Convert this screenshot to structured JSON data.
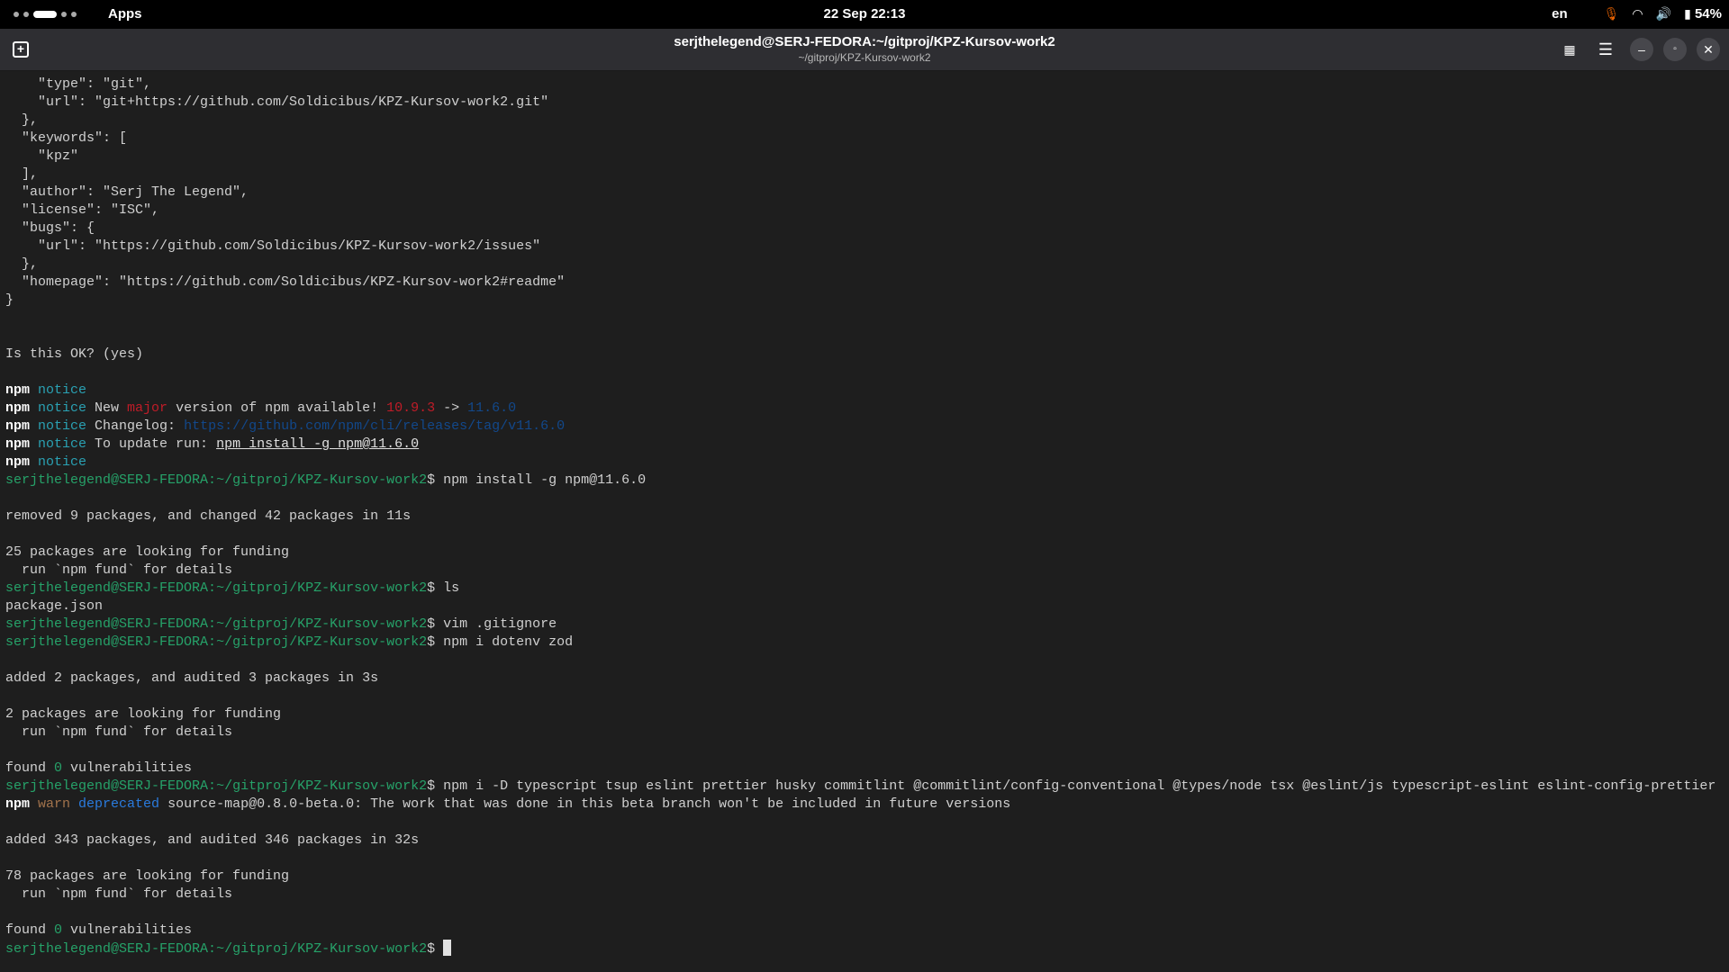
{
  "topbar": {
    "apps": "Apps",
    "datetime": "22 Sep  22:13",
    "lang": "en",
    "battery": "54%"
  },
  "window": {
    "title": "serjthelegend@SERJ-FEDORA:~/gitproj/KPZ-Kursov-work2",
    "subtitle": "~/gitproj/KPZ-Kursov-work2"
  },
  "colors": {
    "prompt": "#26a269",
    "notice": "#2aa1b3",
    "major": "#c01c28",
    "link": "#12488b",
    "warn": "#a2734c",
    "deprecated": "#2a7bde",
    "background": "#1e1e1e"
  },
  "terminal": {
    "lines": [
      [
        [
          "    \"type\": \"git\",",
          ""
        ]
      ],
      [
        [
          "    \"url\": \"git+https://github.com/Soldicibus/KPZ-Kursov-work2.git\"",
          ""
        ]
      ],
      [
        [
          "  },",
          ""
        ]
      ],
      [
        [
          "  \"keywords\": [",
          ""
        ]
      ],
      [
        [
          "    \"kpz\"",
          ""
        ]
      ],
      [
        [
          "  ],",
          ""
        ]
      ],
      [
        [
          "  \"author\": \"Serj The Legend\",",
          ""
        ]
      ],
      [
        [
          "  \"license\": \"ISC\",",
          ""
        ]
      ],
      [
        [
          "  \"bugs\": {",
          ""
        ]
      ],
      [
        [
          "    \"url\": \"https://github.com/Soldicibus/KPZ-Kursov-work2/issues\"",
          ""
        ]
      ],
      [
        [
          "  },",
          ""
        ]
      ],
      [
        [
          "  \"homepage\": \"https://github.com/Soldicibus/KPZ-Kursov-work2#readme\"",
          ""
        ]
      ],
      [
        [
          "}",
          ""
        ]
      ],
      [],
      [],
      [
        [
          "Is this OK? (yes)",
          ""
        ]
      ],
      [],
      [
        [
          "npm",
          "w"
        ],
        [
          " notice",
          "c"
        ]
      ],
      [
        [
          "npm",
          "w"
        ],
        [
          " notice",
          "c"
        ],
        [
          " New ",
          ""
        ],
        [
          "major",
          "r"
        ],
        [
          " version of npm available! ",
          ""
        ],
        [
          "10.9.3",
          "r"
        ],
        [
          " -> ",
          ""
        ],
        [
          "11.6.0",
          "db"
        ]
      ],
      [
        [
          "npm",
          "w"
        ],
        [
          " notice",
          "c"
        ],
        [
          " Changelog: ",
          ""
        ],
        [
          "https://github.com/npm/cli/releases/tag/v11.6.0",
          "db"
        ]
      ],
      [
        [
          "npm",
          "w"
        ],
        [
          " notice",
          "c"
        ],
        [
          " To update run: ",
          ""
        ],
        [
          "npm install -g npm@11.6.0",
          "u"
        ]
      ],
      [
        [
          "npm",
          "w"
        ],
        [
          " notice",
          "c"
        ]
      ],
      [
        [
          "serjthelegend@SERJ-FEDORA",
          "g"
        ],
        [
          ":",
          "g"
        ],
        [
          "~/gitproj/KPZ-Kursov-work2",
          "g"
        ],
        [
          "$ npm install -g npm@11.6.0",
          ""
        ]
      ],
      [],
      [
        [
          "removed 9 packages, and changed 42 packages in 11s",
          ""
        ]
      ],
      [],
      [
        [
          "25 packages are looking for funding",
          ""
        ]
      ],
      [
        [
          "  run `npm fund` for details",
          ""
        ]
      ],
      [
        [
          "serjthelegend@SERJ-FEDORA",
          "g"
        ],
        [
          ":",
          "g"
        ],
        [
          "~/gitproj/KPZ-Kursov-work2",
          "g"
        ],
        [
          "$ ls",
          ""
        ]
      ],
      [
        [
          "package.json",
          ""
        ]
      ],
      [
        [
          "serjthelegend@SERJ-FEDORA",
          "g"
        ],
        [
          ":",
          "g"
        ],
        [
          "~/gitproj/KPZ-Kursov-work2",
          "g"
        ],
        [
          "$ vim .gitignore",
          ""
        ]
      ],
      [
        [
          "serjthelegend@SERJ-FEDORA",
          "g"
        ],
        [
          ":",
          "g"
        ],
        [
          "~/gitproj/KPZ-Kursov-work2",
          "g"
        ],
        [
          "$ npm i dotenv zod",
          ""
        ]
      ],
      [],
      [
        [
          "added 2 packages, and audited 3 packages in 3s",
          ""
        ]
      ],
      [],
      [
        [
          "2 packages are looking for funding",
          ""
        ]
      ],
      [
        [
          "  run `npm fund` for details",
          ""
        ]
      ],
      [],
      [
        [
          "found ",
          ""
        ],
        [
          "0",
          "g"
        ],
        [
          " vulnerabilities",
          ""
        ]
      ],
      [
        [
          "serjthelegend@SERJ-FEDORA",
          "g"
        ],
        [
          ":",
          "g"
        ],
        [
          "~/gitproj/KPZ-Kursov-work2",
          "g"
        ],
        [
          "$ npm i -D typescript tsup eslint prettier husky commitlint @commitlint/config-conventional @types/node tsx @eslint/js typescript-eslint eslint-config-prettier",
          ""
        ]
      ],
      [
        [
          "npm",
          "w"
        ],
        [
          " warn",
          "o"
        ],
        [
          " deprecated",
          "b"
        ],
        [
          " source-map@0.8.0-beta.0: The work that was done in this beta branch won't be included in future versions",
          ""
        ]
      ],
      [],
      [
        [
          "added 343 packages, and audited 346 packages in 32s",
          ""
        ]
      ],
      [],
      [
        [
          "78 packages are looking for funding",
          ""
        ]
      ],
      [
        [
          "  run `npm fund` for details",
          ""
        ]
      ],
      [],
      [
        [
          "found ",
          ""
        ],
        [
          "0",
          "g"
        ],
        [
          " vulnerabilities",
          ""
        ]
      ],
      [
        [
          "serjthelegend@SERJ-FEDORA",
          "g"
        ],
        [
          ":",
          "g"
        ],
        [
          "~/gitproj/KPZ-Kursov-work2",
          "g"
        ],
        [
          "$ ",
          ""
        ]
      ]
    ]
  }
}
